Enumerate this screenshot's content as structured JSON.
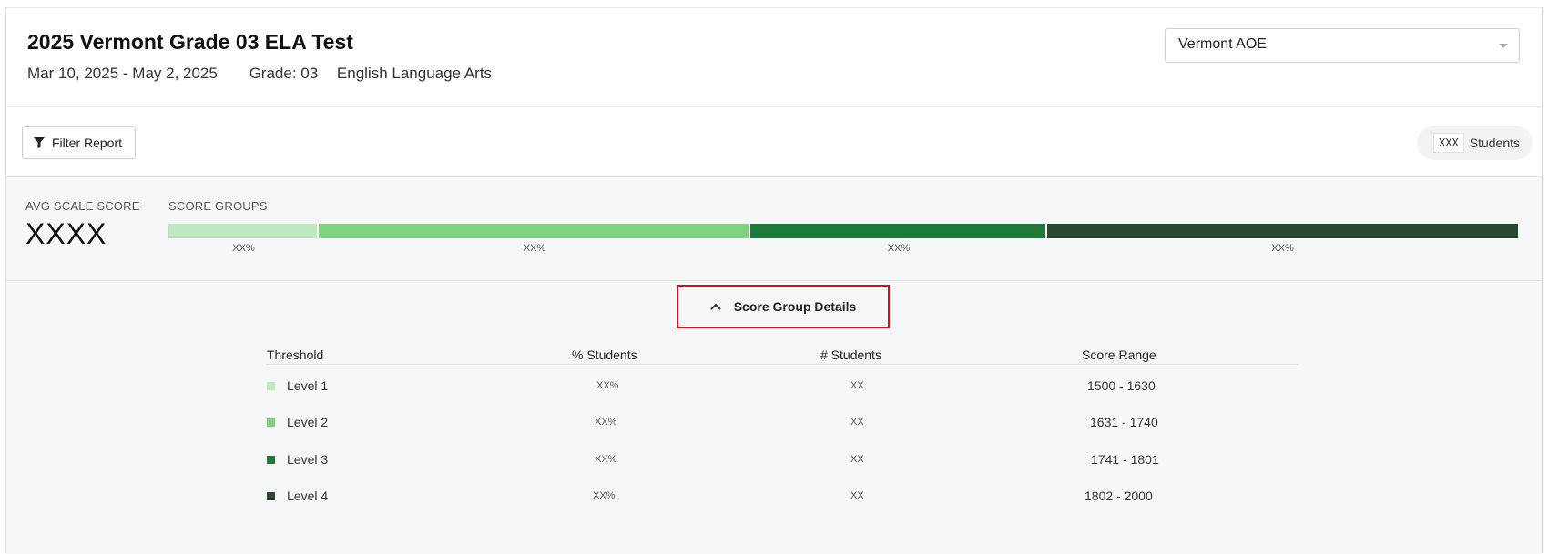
{
  "header": {
    "title": "2025 Vermont Grade 03 ELA Test",
    "dates": "Mar 10, 2025 - May 2, 2025",
    "grade": "Grade: 03",
    "subject": "English Language Arts",
    "org_select": "Vermont AOE"
  },
  "toolbar": {
    "filter_label": "Filter Report",
    "students_count": "XXX",
    "students_label": "Students"
  },
  "summary": {
    "avg_label": "AVG SCALE SCORE",
    "avg_value": "XXXX",
    "groups_label": "SCORE GROUPS",
    "segments": [
      {
        "pct": "XX%",
        "share": 0.111,
        "color": "#c0e8c0"
      },
      {
        "pct": "XX%",
        "share": 0.32,
        "color": "#7fd07f"
      },
      {
        "pct": "XX%",
        "share": 0.22,
        "color": "#1f7a3a"
      },
      {
        "pct": "XX%",
        "share": 0.349,
        "color": "#2a4a30"
      }
    ]
  },
  "details": {
    "toggle_label": "Score Group Details",
    "columns": [
      "Threshold",
      "% Students",
      "# Students",
      "Score Range"
    ],
    "rows": [
      {
        "level": "Level 1",
        "pct": "XX%",
        "count": "XX",
        "range": "1500 - 1630",
        "color": "#c0e8c0"
      },
      {
        "level": "Level 2",
        "pct": "XX%",
        "count": "XX",
        "range": "1631 - 1740",
        "color": "#7fd07f"
      },
      {
        "level": "Level 3",
        "pct": "XX%",
        "count": "XX",
        "range": "1741 - 1801",
        "color": "#1f7a3a"
      },
      {
        "level": "Level 4",
        "pct": "XX%",
        "count": "XX",
        "range": "1802 - 2000",
        "color": "#2a4a30"
      }
    ]
  }
}
